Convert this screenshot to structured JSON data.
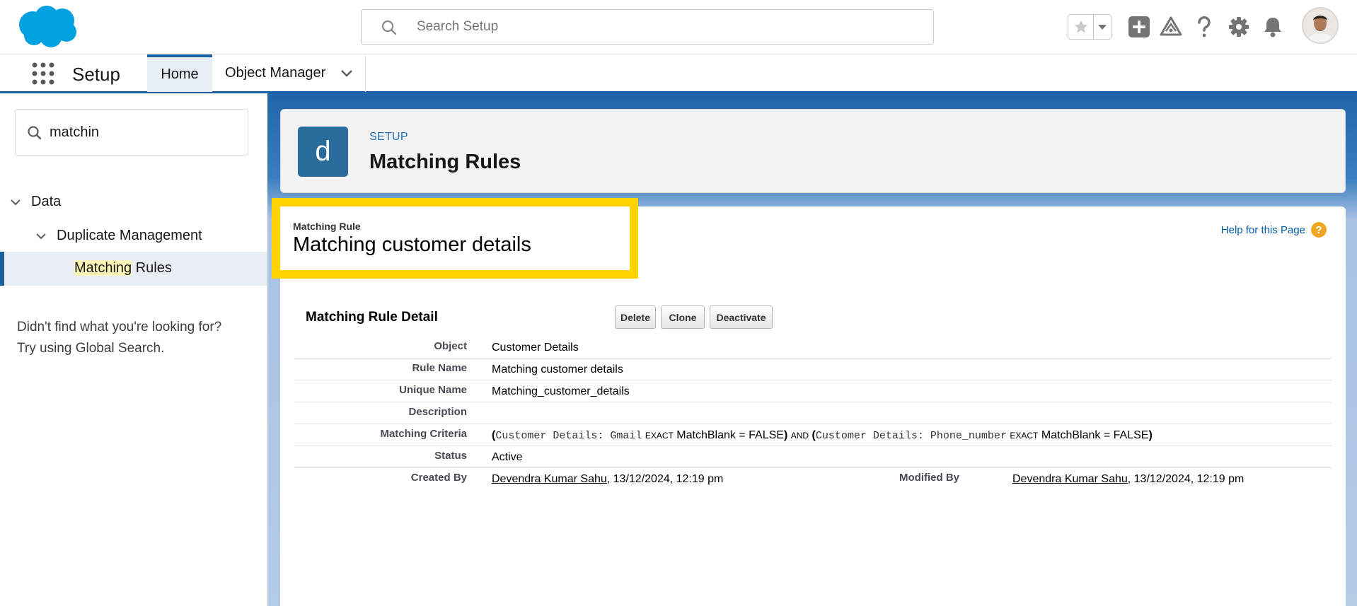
{
  "header": {
    "search_placeholder": "Search Setup"
  },
  "nav": {
    "app_name": "Setup",
    "tabs": [
      {
        "label": "Home"
      },
      {
        "label": "Object Manager"
      }
    ]
  },
  "sidebar": {
    "quickfind_value": "matchin",
    "tree": {
      "data": "Data",
      "duplicate_management": "Duplicate Management",
      "matching_rules_highlight": "Matching",
      "matching_rules_rest": " Rules"
    },
    "not_found_line1": "Didn't find what you're looking for?",
    "not_found_line2": "Try using Global Search."
  },
  "page_header": {
    "icon_letter": "d",
    "eyebrow": "SETUP",
    "title": "Matching Rules"
  },
  "rule": {
    "type_label": "Matching Rule",
    "name": "Matching customer details",
    "help_text": "Help for this Page",
    "help_glyph": "?"
  },
  "detail": {
    "section_title": "Matching Rule Detail",
    "buttons": {
      "delete": "Delete",
      "clone": "Clone",
      "deactivate": "Deactivate"
    },
    "fields": {
      "object_label": "Object",
      "object_value": "Customer Details",
      "rule_name_label": "Rule Name",
      "rule_name_value": "Matching customer details",
      "unique_name_label": "Unique Name",
      "unique_name_value": "Matching_customer_details",
      "description_label": "Description",
      "description_value": "",
      "criteria_label": "Matching Criteria",
      "criteria": {
        "field1": "Customer Details: Gmail",
        "op1": "EXACT",
        "blank1": "MatchBlank = FALSE",
        "joiner": "AND",
        "field2": "Customer Details: Phone_number",
        "op2": "EXACT",
        "blank2": "MatchBlank = FALSE"
      },
      "status_label": "Status",
      "status_value": "Active",
      "created_by_label": "Created By",
      "created_by_name": "Devendra Kumar Sahu",
      "created_by_date": ", 13/12/2024, 12:19 pm",
      "modified_by_label": "Modified By",
      "modified_by_name": "Devendra Kumar Sahu",
      "modified_by_date": ", 13/12/2024, 12:19 pm"
    }
  },
  "colors": {
    "brand_blue": "#1b5f9e",
    "highlight_yellow": "#ffd300",
    "salesforce_cloud": "#00a1e0",
    "help_orange": "#f0a623"
  }
}
